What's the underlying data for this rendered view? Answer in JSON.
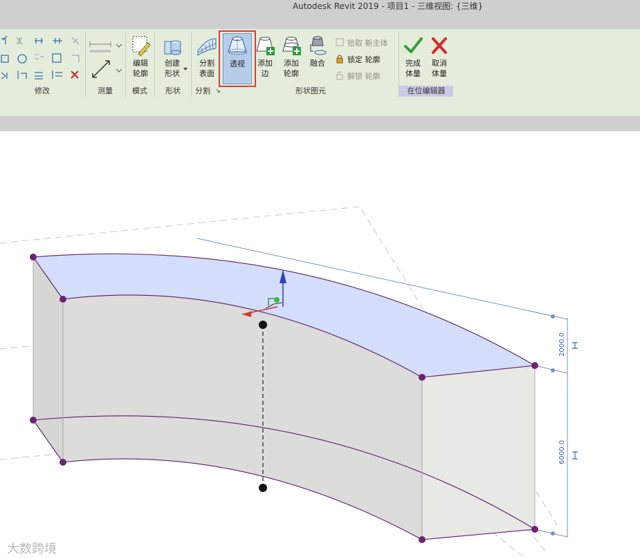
{
  "window": {
    "title": "Autodesk Revit 2019 - 项目1 - 三维视图: {三维}"
  },
  "ribbon": {
    "panels": {
      "modify": "修改",
      "measure": "测量",
      "mode": "模式",
      "shape": "形状",
      "split": "分割",
      "split_launcher": "↘",
      "shape_element": "形状图元",
      "inplace_editor": "在位编辑器"
    },
    "tools": {
      "edit_profile": "编辑\n轮廓",
      "create_form": "创建\n形状",
      "divide_surface": "分割\n表面",
      "xray": "透视",
      "add_edge": "添加\n边",
      "add_profile": "添加\n轮廓",
      "blend": "融合",
      "pick_new_host": "拾取 新主体",
      "lock_profile": "锁定 轮廓",
      "unlock_profile": "解锁 轮廓",
      "finish_mass": "完成\n体量",
      "cancel_mass": "取消\n体量"
    },
    "selected_tool": "透视"
  },
  "viewport": {
    "dimensions": [
      "2000.0",
      "6000.0"
    ],
    "colors": {
      "top_face": "#d4defa",
      "side_face": "#dcdcdc",
      "edge": "#5a1e66",
      "vertex": "#6b2472",
      "dimension": "#3a66b5"
    }
  },
  "watermark": "大数跨境"
}
